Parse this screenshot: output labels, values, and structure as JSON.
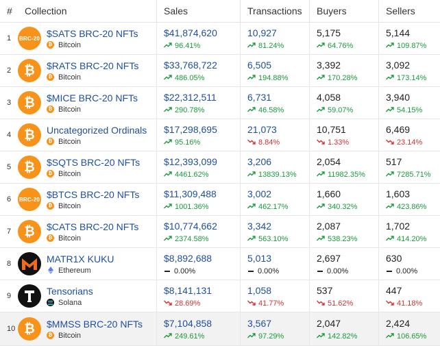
{
  "headers": {
    "num": "#",
    "collection": "Collection",
    "sales": "Sales",
    "transactions": "Transactions",
    "buyers": "Buyers",
    "sellers": "Sellers"
  },
  "colors": {
    "up": "#1a9a3a",
    "down": "#d23131",
    "link": "#1e4fa0",
    "bitcoin": "#f7931a"
  },
  "rows": [
    {
      "num": "1",
      "name": "$SATS BRC-20 NFTs",
      "avatar": "brc20",
      "avatar_text": "BRC-20",
      "chain": "Bitcoin",
      "chain_icon": "bitcoin-icon",
      "sales": "$41,874,620",
      "sales_change": "96.41%",
      "sales_dir": "up",
      "tx": "10,927",
      "tx_change": "81.24%",
      "tx_dir": "up",
      "buyers": "5,175",
      "buyers_change": "64.76%",
      "buyers_dir": "up",
      "sellers": "5,144",
      "sellers_change": "109.87%",
      "sellers_dir": "up"
    },
    {
      "num": "2",
      "name": "$RATS BRC-20 NFTs",
      "avatar": "bitcoin",
      "chain": "Bitcoin",
      "chain_icon": "bitcoin-icon",
      "sales": "$33,768,722",
      "sales_change": "486.05%",
      "sales_dir": "up",
      "tx": "6,505",
      "tx_change": "194.88%",
      "tx_dir": "up",
      "buyers": "3,392",
      "buyers_change": "170.28%",
      "buyers_dir": "up",
      "sellers": "3,092",
      "sellers_change": "173.14%",
      "sellers_dir": "up"
    },
    {
      "num": "3",
      "name": "$MICE BRC-20 NFTs",
      "avatar": "bitcoin",
      "chain": "Bitcoin",
      "chain_icon": "bitcoin-icon",
      "sales": "$22,312,511",
      "sales_change": "290.78%",
      "sales_dir": "up",
      "tx": "6,731",
      "tx_change": "46.58%",
      "tx_dir": "up",
      "buyers": "4,058",
      "buyers_change": "59.07%",
      "buyers_dir": "up",
      "sellers": "3,940",
      "sellers_change": "54.15%",
      "sellers_dir": "up"
    },
    {
      "num": "4",
      "name": "Uncategorized Ordinals",
      "avatar": "bitcoin",
      "chain": "Bitcoin",
      "chain_icon": "bitcoin-icon",
      "sales": "$17,298,695",
      "sales_change": "95.16%",
      "sales_dir": "up",
      "tx": "21,073",
      "tx_change": "8.84%",
      "tx_dir": "down",
      "buyers": "10,751",
      "buyers_change": "1.33%",
      "buyers_dir": "down",
      "sellers": "6,469",
      "sellers_change": "23.14%",
      "sellers_dir": "down"
    },
    {
      "num": "5",
      "name": "$SQTS BRC-20 NFTs",
      "avatar": "bitcoin",
      "chain": "Bitcoin",
      "chain_icon": "bitcoin-icon",
      "sales": "$12,393,099",
      "sales_change": "4461.62%",
      "sales_dir": "up",
      "tx": "3,206",
      "tx_change": "13839.13%",
      "tx_dir": "up",
      "buyers": "2,054",
      "buyers_change": "11982.35%",
      "buyers_dir": "up",
      "sellers": "517",
      "sellers_change": "7285.71%",
      "sellers_dir": "up"
    },
    {
      "num": "6",
      "name": "$BTCS BRC-20 NFTs",
      "avatar": "brc20",
      "avatar_text": "BRC-20",
      "chain": "Bitcoin",
      "chain_icon": "bitcoin-icon",
      "sales": "$11,309,488",
      "sales_change": "1001.36%",
      "sales_dir": "up",
      "tx": "3,002",
      "tx_change": "462.17%",
      "tx_dir": "up",
      "buyers": "1,660",
      "buyers_change": "340.32%",
      "buyers_dir": "up",
      "sellers": "1,603",
      "sellers_change": "423.86%",
      "sellers_dir": "up"
    },
    {
      "num": "7",
      "name": "$CATS BRC-20 NFTs",
      "avatar": "bitcoin",
      "chain": "Bitcoin",
      "chain_icon": "bitcoin-icon",
      "sales": "$10,774,662",
      "sales_change": "2374.58%",
      "sales_dir": "up",
      "tx": "3,342",
      "tx_change": "563.10%",
      "tx_dir": "up",
      "buyers": "2,087",
      "buyers_change": "538.23%",
      "buyers_dir": "up",
      "sellers": "1,702",
      "sellers_change": "414.20%",
      "sellers_dir": "up"
    },
    {
      "num": "8",
      "name": "MATR1X KUKU",
      "avatar": "matr1x",
      "chain": "Ethereum",
      "chain_icon": "ethereum-icon",
      "sales": "$8,892,688",
      "sales_change": "0.00%",
      "sales_dir": "flat",
      "tx": "5,013",
      "tx_change": "0.00%",
      "tx_dir": "flat",
      "buyers": "2,697",
      "buyers_change": "0.00%",
      "buyers_dir": "flat",
      "sellers": "630",
      "sellers_change": "0.00%",
      "sellers_dir": "flat"
    },
    {
      "num": "9",
      "name": "Tensorians",
      "avatar": "tensorians",
      "chain": "Solana",
      "chain_icon": "solana-icon",
      "sales": "$8,141,131",
      "sales_change": "28.69%",
      "sales_dir": "down",
      "tx": "1,058",
      "tx_change": "41.77%",
      "tx_dir": "down",
      "buyers": "537",
      "buyers_change": "51.62%",
      "buyers_dir": "down",
      "sellers": "447",
      "sellers_change": "41.18%",
      "sellers_dir": "down"
    },
    {
      "num": "10",
      "name": "$MMSS BRC-20 NFTs",
      "avatar": "bitcoin",
      "chain": "Bitcoin",
      "chain_icon": "bitcoin-icon",
      "sales": "$7,104,858",
      "sales_change": "249.61%",
      "sales_dir": "up",
      "tx": "3,567",
      "tx_change": "97.29%",
      "tx_dir": "up",
      "buyers": "2,047",
      "buyers_change": "142.82%",
      "buyers_dir": "up",
      "sellers": "2,424",
      "sellers_change": "106.65%",
      "sellers_dir": "up"
    }
  ]
}
